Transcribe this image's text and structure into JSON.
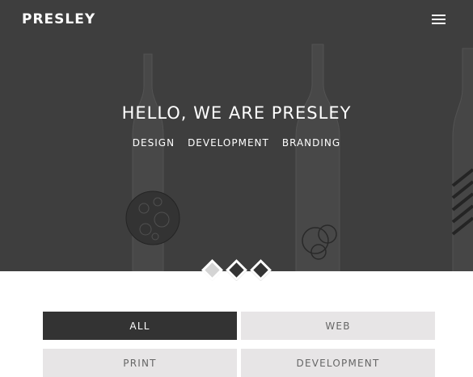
{
  "header": {
    "brand": "PRESLEY",
    "menu_icon": "hamburger-icon"
  },
  "hero": {
    "title": "HELLO, WE ARE PRESLEY",
    "services": [
      "DESIGN",
      "DEVELOPMENT",
      "BRANDING"
    ],
    "background": "bottles-photo",
    "slides": {
      "count": 3,
      "active": 1
    }
  },
  "portfolio": {
    "filters": [
      "ALL",
      "WEB",
      "PRINT",
      "DEVELOPMENT"
    ],
    "active_filter": "ALL"
  },
  "colors": {
    "hero_bg": "#4a4a4a",
    "dark": "#333333",
    "filter_bg": "#e7e5e6"
  }
}
